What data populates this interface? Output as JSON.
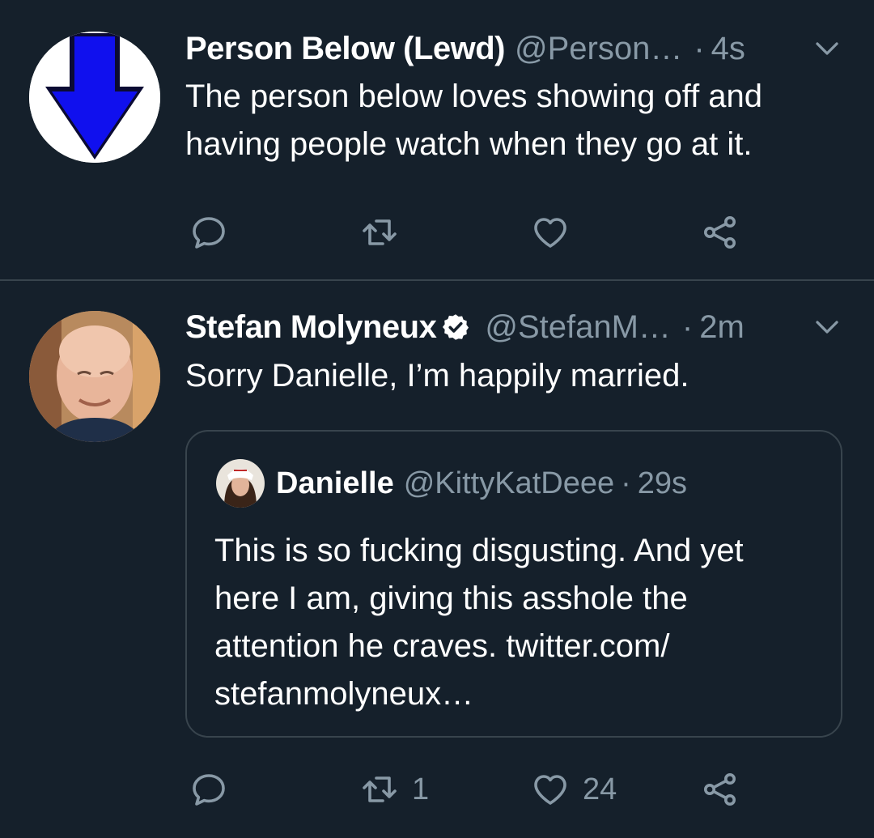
{
  "tweets": [
    {
      "name": "Person Below (Lewd)",
      "handle": "@Person…",
      "time": "4s",
      "text": "The person below loves showing off and having people watch when they go at it.",
      "avatar": "blue-down-arrow-avatar",
      "actions": {
        "reply_count": "",
        "retweet_count": "",
        "like_count": ""
      }
    },
    {
      "name": "Stefan Molyneux",
      "verified": true,
      "handle": "@StefanM…",
      "time": "2m",
      "text": "Sorry Danielle, I’m happily married.",
      "avatar": "man-portrait-avatar",
      "quote": {
        "name": "Danielle",
        "handle": "@KittyKatDeee",
        "time": "29s",
        "text": "This is so fucking disgusting. And yet here I am, giving this asshole the attention he craves. twitter.com/ stefanmolyneux…"
      },
      "actions": {
        "reply_count": "",
        "retweet_count": "1",
        "like_count": "24"
      }
    }
  ],
  "separator": "·",
  "icons": [
    "reply-icon",
    "retweet-icon",
    "like-icon",
    "share-icon",
    "chevron-down-icon",
    "verified-badge-icon"
  ],
  "colors": {
    "background": "#15202b",
    "text": "#ffffff",
    "muted": "#8899a6",
    "border": "#38444d"
  }
}
